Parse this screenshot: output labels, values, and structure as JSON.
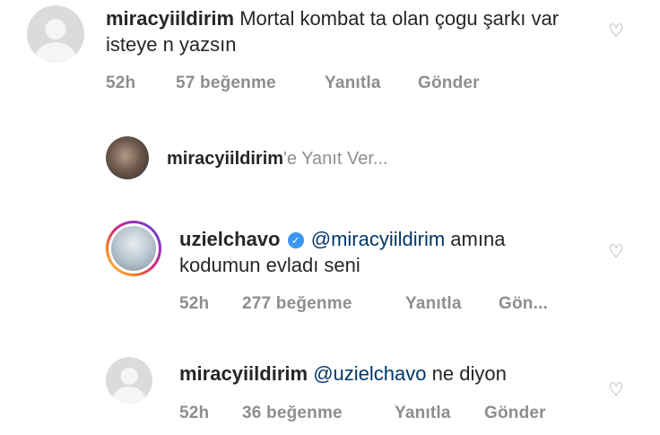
{
  "comments": [
    {
      "username": "miracyiildirim",
      "text": "Mortal kombat ta olan çogu şarkı var isteye n yazsın",
      "time": "52h",
      "likes": "57 beğenme",
      "reply_label": "Yanıtla",
      "send_label": "Gönder"
    },
    {
      "username": "uzielchavo",
      "mention": "@miracyiildirim",
      "text_line1": "amına",
      "text_line2": "kodumun evladı seni",
      "time": "52h",
      "likes": "277 beğenme",
      "reply_label": "Yanıtla",
      "send_label": "Gön..."
    },
    {
      "username": "miracyiildirim",
      "mention": "@uzielchavo",
      "text": "ne diyon",
      "time": "52h",
      "likes": "36 beğenme",
      "reply_label": "Yanıtla",
      "send_label": "Gönder"
    }
  ],
  "reply_prompt": {
    "username": "miracyiildirim",
    "suffix": "'e Yanıt Ver..."
  },
  "icons": {
    "heart": "♡",
    "verified": "✓"
  },
  "colors": {
    "mention": "#00376b",
    "meta": "#8e8e8e",
    "verified": "#3897f0"
  }
}
